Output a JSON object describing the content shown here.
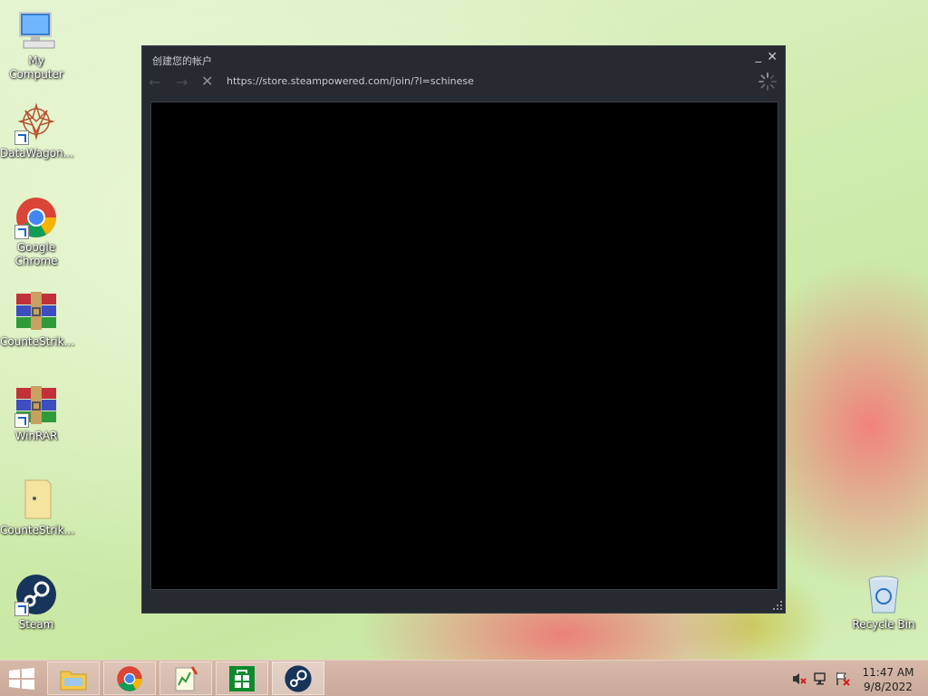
{
  "desktop": {
    "icons": [
      {
        "label": "My Computer"
      },
      {
        "label": "DataWagon..."
      },
      {
        "label": "Google Chrome"
      },
      {
        "label": "CounteStrik..."
      },
      {
        "label": "WinRAR"
      },
      {
        "label": "CounteStrik..."
      },
      {
        "label": "Steam"
      },
      {
        "label": "Recycle Bin"
      }
    ]
  },
  "window": {
    "title": "创建您的帐户",
    "minimize": "_",
    "close": "✕",
    "back": "←",
    "forward": "→",
    "stop": "✕",
    "url": "https://store.steampowered.com/join/?l=schinese"
  },
  "taskbar": {
    "time": "11:47 AM",
    "date": "9/8/2022"
  }
}
